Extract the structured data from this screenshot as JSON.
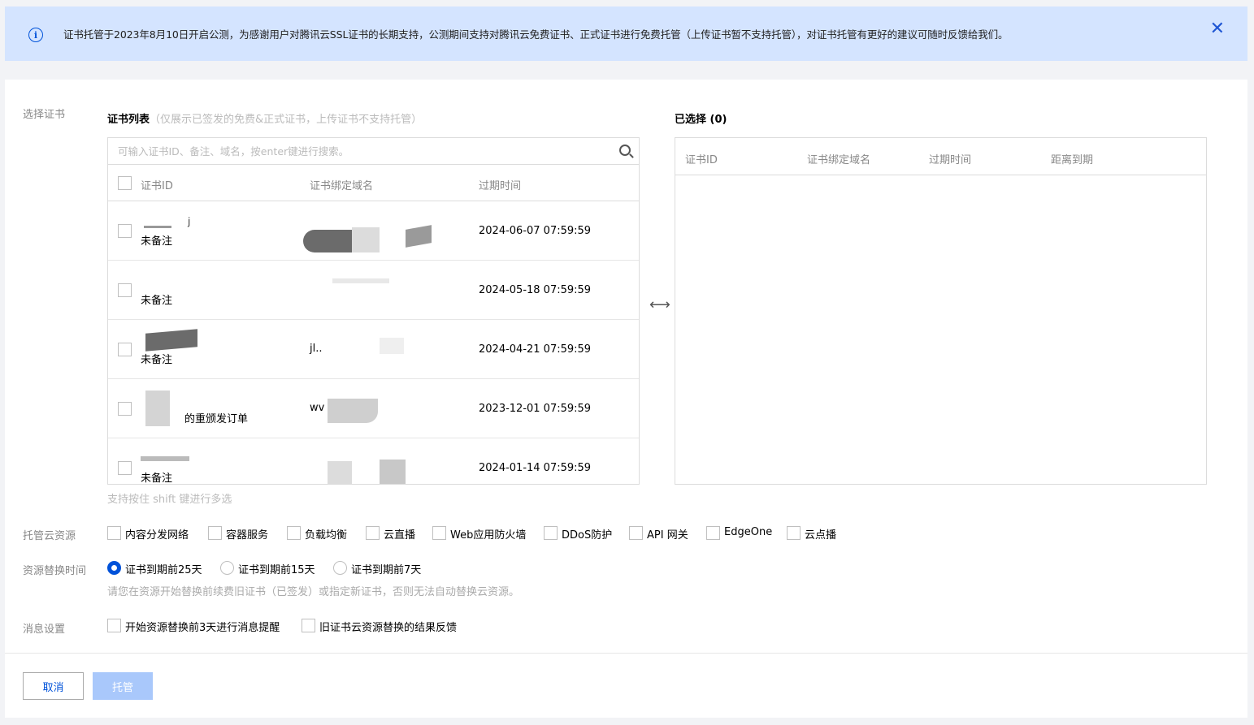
{
  "notice": {
    "text": "证书托管于2023年8月10日开启公测，为感谢用户对腾讯云SSL证书的长期支持，公测期间支持对腾讯云免费证书、正式证书进行免费托管（上传证书暂不支持托管），对证书托管有更好的建议可随时反馈给我们。",
    "info_icon": "info-icon",
    "close_icon": "close-icon"
  },
  "labels": {
    "select_cert": "选择证书",
    "resources": "托管云资源",
    "replace_time": "资源替换时间",
    "message": "消息设置"
  },
  "cert_list": {
    "title": "证书列表",
    "subtitle": "（仅展示已签发的免费&正式证书，上传证书不支持托管）",
    "search_placeholder": "可输入证书ID、备注、域名，按enter键进行搜索。",
    "columns": [
      "证书ID",
      "证书绑定域名",
      "过期时间"
    ],
    "rows": [
      {
        "id_text": "j",
        "note": "未备注",
        "domain": "",
        "expire": "2024-06-07 07:59:59"
      },
      {
        "id_text": "",
        "note": "未备注",
        "domain": "",
        "expire": "2024-05-18 07:59:59"
      },
      {
        "id_text": "",
        "note": "未备注",
        "domain": "jl..",
        "expire": "2024-04-21 07:59:59"
      },
      {
        "id_text": "",
        "note": "的重颁发订单",
        "domain": "wv  .cn",
        "expire": "2023-12-01 07:59:59"
      },
      {
        "id_text": "",
        "note": "未备注",
        "domain": "",
        "expire": "2024-01-14 07:59:59"
      }
    ],
    "hint": "支持按住 shift 键进行多选"
  },
  "selected": {
    "title": "已选择 (0)",
    "columns": [
      "证书ID",
      "证书绑定域名",
      "过期时间",
      "距离到期"
    ]
  },
  "resources": [
    "内容分发网络",
    "容器服务",
    "负载均衡",
    "云直播",
    "Web应用防火墙",
    "DDoS防护",
    "API 网关",
    "EdgeOne",
    "云点播"
  ],
  "replace_options": [
    {
      "label": "证书到期前25天",
      "checked": true
    },
    {
      "label": "证书到期前15天",
      "checked": false
    },
    {
      "label": "证书到期前7天",
      "checked": false
    }
  ],
  "replace_note": "请您在资源开始替换前续费旧证书（已签发）或指定新证书，否则无法自动替换云资源。",
  "message_options": [
    "开始资源替换前3天进行消息提醒",
    "旧证书云资源替换的结果反馈"
  ],
  "buttons": {
    "cancel": "取消",
    "host": "托管"
  },
  "colors": {
    "primary": "#0052d9",
    "notice_bg": "#d4e4ff",
    "disabled_btn": "#a9c8fb"
  }
}
